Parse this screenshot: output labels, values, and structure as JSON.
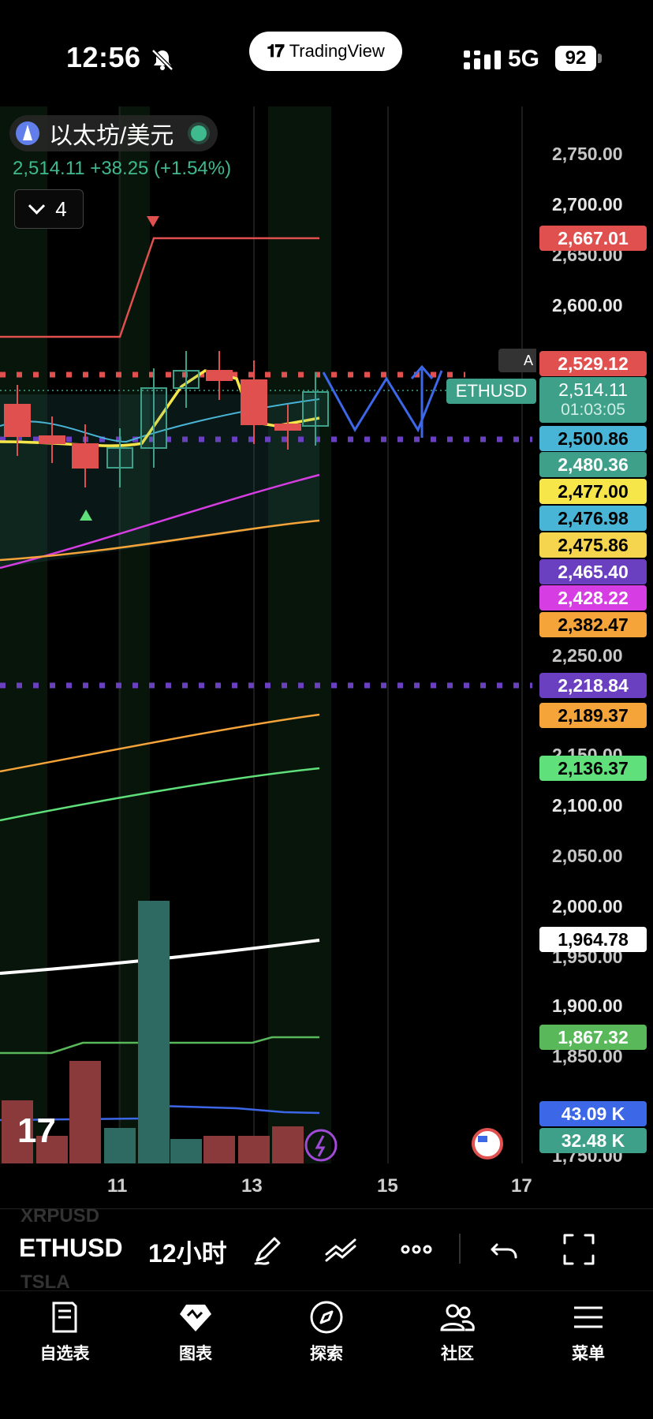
{
  "status_bar": {
    "time": "12:56",
    "app_pill": "TradingView",
    "network": "5G",
    "battery": "92",
    "icons": [
      "bell-muted-icon",
      "signal-icon",
      "battery-icon"
    ]
  },
  "symbol": {
    "name": "以太坊/美元",
    "price_line": "2,514.11  +38.25 (+1.54%)",
    "indicator_count": "4"
  },
  "colors": {
    "up_green": "#3fa08a",
    "down_red": "#e0504f",
    "axis_text": "#c7c7c7",
    "background": "#000000"
  },
  "price_axis": [
    {
      "value": "2,750.00",
      "bold": false
    },
    {
      "value": "2,700.00",
      "bold": true
    },
    {
      "value": "2,650.00",
      "bold": false
    },
    {
      "value": "2,600.00",
      "bold": true
    },
    {
      "value": "2,250.00",
      "bold": false
    },
    {
      "value": "2,150.00",
      "bold": false
    },
    {
      "value": "2,100.00",
      "bold": true
    },
    {
      "value": "2,050.00",
      "bold": false
    },
    {
      "value": "2,000.00",
      "bold": true
    },
    {
      "value": "1,950.00",
      "bold": false
    },
    {
      "value": "1,900.00",
      "bold": true
    },
    {
      "value": "1,850.00",
      "bold": false
    },
    {
      "value": "1,750.00",
      "bold": false
    }
  ],
  "price_tags": [
    {
      "value": "2,667.01",
      "bg": "#e0504f",
      "fg": "#ffffff"
    },
    {
      "value": "2,529.12",
      "bg": "#e0504f",
      "fg": "#ffffff"
    },
    {
      "value": "2,500.86",
      "bg": "#48b4d6",
      "fg": "#000000"
    },
    {
      "value": "2,480.36",
      "bg": "#3fa08a",
      "fg": "#ffffff"
    },
    {
      "value": "2,477.00",
      "bg": "#f7e64a",
      "fg": "#000000"
    },
    {
      "value": "2,476.98",
      "bg": "#48b4d6",
      "fg": "#000000"
    },
    {
      "value": "2,475.86",
      "bg": "#f5d54d",
      "fg": "#000000"
    },
    {
      "value": "2,465.40",
      "bg": "#6a3fc0",
      "fg": "#ffffff"
    },
    {
      "value": "2,428.22",
      "bg": "#d63de3",
      "fg": "#ffffff"
    },
    {
      "value": "2,382.47",
      "bg": "#f5a43a",
      "fg": "#000000"
    },
    {
      "value": "2,218.84",
      "bg": "#6a3fc0",
      "fg": "#ffffff"
    },
    {
      "value": "2,189.37",
      "bg": "#f5a43a",
      "fg": "#000000"
    },
    {
      "value": "2,136.37",
      "bg": "#5fe07a",
      "fg": "#000000"
    },
    {
      "value": "1,964.78",
      "bg": "#ffffff",
      "fg": "#000000"
    },
    {
      "value": "1,867.32",
      "bg": "#58b85a",
      "fg": "#ffffff"
    },
    {
      "value": "43.09 K",
      "bg": "#3c68e8",
      "fg": "#ffffff"
    },
    {
      "value": "32.48 K",
      "bg": "#3fa08a",
      "fg": "#ffffff"
    }
  ],
  "last_price": {
    "symbol_tag": "ETHUSD",
    "value": "2,514.11",
    "countdown": "01:03:05",
    "alert_tag": "A"
  },
  "x_axis": [
    "11",
    "13",
    "15",
    "17"
  ],
  "toolbar": {
    "ghost_above": "XRPUSD",
    "symbol": "ETHUSD",
    "interval": "12小时",
    "ghost_below": "TSLA"
  },
  "nav": [
    {
      "label": "自选表",
      "icon": "watchlist-icon"
    },
    {
      "label": "图表",
      "icon": "chart-icon"
    },
    {
      "label": "探索",
      "icon": "compass-icon"
    },
    {
      "label": "社区",
      "icon": "community-icon"
    },
    {
      "label": "菜单",
      "icon": "menu-icon"
    }
  ]
}
